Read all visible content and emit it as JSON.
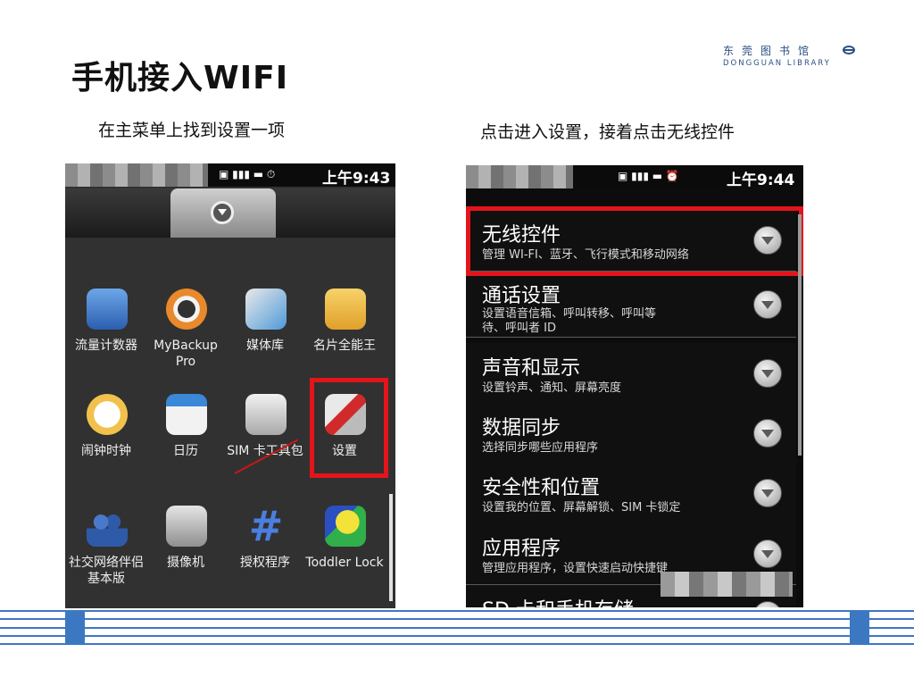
{
  "title": "手机接入WIFI",
  "logo": {
    "cn": "东莞图书馆",
    "en": "DONGGUAN LIBRARY",
    "mark": "library-logo-icon"
  },
  "captions": {
    "left": "在主菜单上找到设置一项",
    "right": "点击进入设置，接着点击无线控件"
  },
  "left_phone": {
    "status": {
      "icons": "▣ ▮▮▮ ▬ ⏱",
      "time": "上午9:43"
    },
    "apps": [
      {
        "label": "流量计数器",
        "icon": "traffic-counter-icon",
        "color": "#3d7fd6"
      },
      {
        "label": "MyBackup Pro",
        "icon": "lifebuoy-icon",
        "color": "#e8892b"
      },
      {
        "label": "媒体库",
        "icon": "gallery-icon",
        "color": "#4f9ad8"
      },
      {
        "label": "名片全能王",
        "icon": "business-card-icon",
        "color": "#f0b83a"
      },
      {
        "label": "闹钟时钟",
        "icon": "alarm-clock-icon",
        "color": "#f2c14c"
      },
      {
        "label": "日历",
        "icon": "calendar-icon",
        "color": "#3a88d8"
      },
      {
        "label": "SIM 卡工具包",
        "icon": "sim-card-icon",
        "color": "#cfcfcf"
      },
      {
        "label": "设置",
        "icon": "settings-tools-icon",
        "color": "#d12a2a"
      },
      {
        "label": "社交网络伴侣基本版",
        "icon": "contacts-icon",
        "color": "#2e5aa8"
      },
      {
        "label": "摄像机",
        "icon": "camcorder-icon",
        "color": "#c9c9c9"
      },
      {
        "label": "授权程序",
        "icon": "hash-icon",
        "color": "#3a6fd0"
      },
      {
        "label": "Toddler Lock",
        "icon": "shapes-icon",
        "color": "#f2e23a"
      }
    ]
  },
  "right_phone": {
    "status": {
      "icons": "▣ ▮▮▮ ▬ ⏰",
      "time": "上午9:44"
    },
    "items": [
      {
        "title": "无线控件",
        "subtitle": "管理 WI-FI、蓝牙、飞行模式和移动网络"
      },
      {
        "title": "通话设置",
        "subtitle": "设置语音信箱、呼叫转移、呼叫等",
        "subtitle2": "待、呼叫者 ID"
      },
      {
        "title": "声音和显示",
        "subtitle": "设置铃声、通知、屏幕亮度"
      },
      {
        "title": "数据同步",
        "subtitle": "选择同步哪些应用程序"
      },
      {
        "title": "安全性和位置",
        "subtitle": "设置我的位置、屏幕解锁、SIM 卡锁定"
      },
      {
        "title": "应用程序",
        "subtitle": "管理应用程序，设置快速启动快捷键"
      },
      {
        "title": "SD 卡和手机存储",
        "subtitle": ""
      }
    ]
  }
}
